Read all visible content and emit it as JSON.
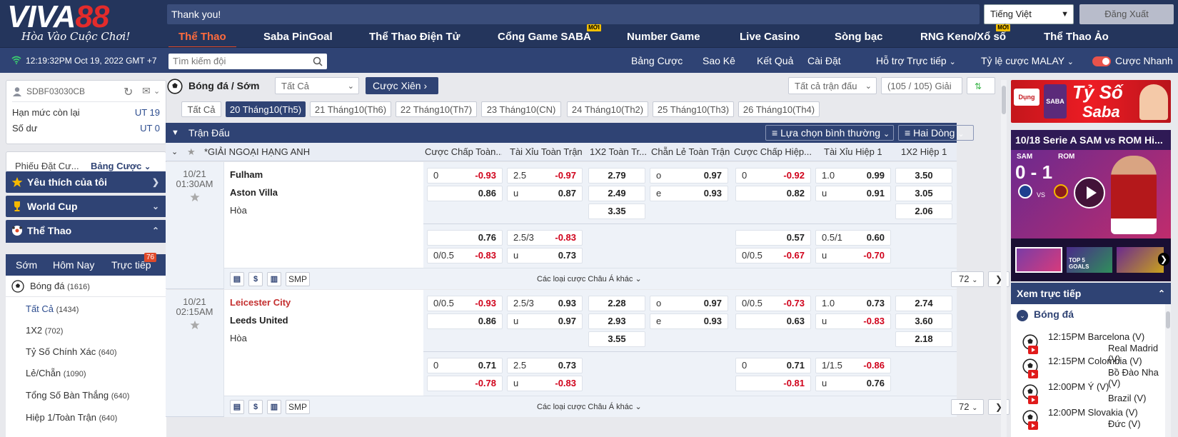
{
  "header": {
    "logo_text": "VIVA",
    "logo_num": "88",
    "logo_slogan": "Hòa Vào Cuộc Chơi!",
    "marquee": "Thank you!",
    "language": "Tiếng Việt",
    "logout": "Đăng Xuất",
    "nav": [
      {
        "label": "Thể Thao",
        "active": true
      },
      {
        "label": "Saba PinGoal"
      },
      {
        "label": "Thể Thao Điện Tử"
      },
      {
        "label": "Cổng Game SABA",
        "badge": "MỚI"
      },
      {
        "label": "Number Game"
      },
      {
        "label": "Live Casino"
      },
      {
        "label": "Sòng bạc"
      },
      {
        "label": "RNG Keno/Xổ số",
        "badge": "MỚI"
      },
      {
        "label": "Thể Thao Ảo"
      }
    ]
  },
  "subbar": {
    "time": "12:19:32PM Oct 19, 2022 GMT +7",
    "search_placeholder": "Tìm kiếm đội",
    "links": [
      "Bảng Cược",
      "Sao Kê",
      "Kết Quả",
      "Cài Đặt",
      "Hỗ trợ Trực tiếp",
      "Tỷ lệ cược MALAY",
      "Cược Nhanh"
    ]
  },
  "account": {
    "id": "SDBF03030CB",
    "limit_label": "Hạn mức còn lại",
    "limit_value": "UT 19",
    "balance_label": "Số dư",
    "balance_value": "UT 0"
  },
  "betslip": {
    "tab1": "Phiếu Đặt Cư...",
    "tab2": "Bảng Cược"
  },
  "sidebar": {
    "favorites": "Yêu thích của tôi",
    "worldcup": "World Cup",
    "sports": "Thể Thao",
    "tabs": [
      "Sớm",
      "Hôm Nay",
      "Trực tiếp"
    ],
    "live_count": "76",
    "items": [
      {
        "label": "Bóng đá",
        "count": "(1616)"
      },
      {
        "label": "Tất Cả",
        "count": "(1434)"
      },
      {
        "label": "1X2",
        "count": "(702)"
      },
      {
        "label": "Tỷ Số Chính Xác",
        "count": "(640)"
      },
      {
        "label": "Lẻ/Chẵn",
        "count": "(1090)"
      },
      {
        "label": "Tổng Số Bàn Thắng",
        "count": "(640)"
      },
      {
        "label": "Hiệp 1/Toàn Trận",
        "count": "(640)"
      }
    ]
  },
  "center": {
    "sport_title": "Bóng đá / Sớm",
    "filter": "Tất Cả",
    "parlay": "Cược Xiên",
    "all_matches": "Tất cả trận đấu",
    "leagues": "(105 / 105) Giải",
    "dates": [
      "Tất Cả",
      "20 Tháng10(Th5)",
      "21 Tháng10(Th6)",
      "22 Tháng10(Th7)",
      "23 Tháng10(CN)",
      "24 Tháng10(Th2)",
      "25 Tháng10(Th3)",
      "26 Tháng10(Th4)"
    ],
    "match_header": "Trận Đấu",
    "view_select": "Lựa chọn bình thường",
    "rows_select": "Hai Dòng",
    "league": "*GIẢI NGOẠI HẠNG ANH",
    "columns": [
      "Cược Chấp Toàn...",
      "Tài Xỉu Toàn Trận",
      "1X2 Toàn Tr...",
      "Chẵn Lẻ Toàn Trận",
      "Cược Chấp Hiệp...",
      "Tài Xỉu Hiệp 1",
      "1X2 Hiệp 1"
    ],
    "more_label": "Các loại cược Châu Á khác",
    "smp": "SMP"
  },
  "matches": [
    {
      "date": "10/21",
      "time": "01:30AM",
      "home": "Fulham",
      "away": "Aston Villa",
      "draw": "Hòa",
      "fav": false,
      "r1": {
        "hdp": [
          "0",
          "-0.93",
          "",
          "0.86"
        ],
        "ou": [
          "2.5",
          "-0.97",
          "u",
          "0.87"
        ],
        "x12": [
          "2.79",
          "2.49",
          "3.35"
        ],
        "oe": [
          "o",
          "0.97",
          "e",
          "0.93"
        ],
        "hhdp": [
          "0",
          "-0.92",
          "",
          "0.82"
        ],
        "hou": [
          "1.0",
          "0.99",
          "u",
          "0.91"
        ],
        "hx12": [
          "3.50",
          "3.05",
          "2.06"
        ]
      },
      "r2": {
        "hdp": [
          "",
          "0.76",
          "0/0.5",
          "-0.83"
        ],
        "ou": [
          "2.5/3",
          "-0.83",
          "u",
          "0.73"
        ],
        "hhdp": [
          "",
          "0.57",
          "0/0.5",
          "-0.67"
        ],
        "hou": [
          "0.5/1",
          "0.60",
          "u",
          "-0.70"
        ]
      },
      "count": "72"
    },
    {
      "date": "10/21",
      "time": "02:15AM",
      "home": "Leicester City",
      "away": "Leeds United",
      "draw": "Hòa",
      "fav": true,
      "r1": {
        "hdp": [
          "0/0.5",
          "-0.93",
          "",
          "0.86"
        ],
        "ou": [
          "2.5/3",
          "0.93",
          "u",
          "0.97"
        ],
        "x12": [
          "2.28",
          "2.93",
          "3.55"
        ],
        "oe": [
          "o",
          "0.97",
          "e",
          "0.93"
        ],
        "hhdp": [
          "0/0.5",
          "-0.73",
          "",
          "0.63"
        ],
        "hou": [
          "1.0",
          "0.73",
          "u",
          "-0.83"
        ],
        "hx12": [
          "2.74",
          "3.60",
          "2.18"
        ]
      },
      "r2": {
        "hdp": [
          "0",
          "0.71",
          "",
          "-0.78"
        ],
        "ou": [
          "2.5",
          "0.73",
          "u",
          "-0.83"
        ],
        "hhdp": [
          "0",
          "0.71",
          "",
          "-0.81"
        ],
        "hou": [
          "1/1.5",
          "-0.86",
          "u",
          "0.76"
        ]
      },
      "count": "72"
    }
  ],
  "right": {
    "banner_title": "Tỷ Số",
    "banner_sub": "Saba",
    "banner_logo": "SABA",
    "banner_brand": "Dụng",
    "video_title": "10/18 Serie A SAM vs ROM Hi...",
    "score_home": "SAM",
    "score_away": "ROM",
    "score": "0 - 1",
    "vs": "VS",
    "thumb_label": "TOP 5 GOALS",
    "live_header": "Xem trực tiếp",
    "live_sport": "Bóng đá",
    "live": [
      {
        "time": "12:15PM",
        "home": "Barcelona (V)",
        "away": "Real Madrid (V)"
      },
      {
        "time": "12:15PM",
        "home": "Colombia (V)",
        "away": "Bồ Đào Nha (V)"
      },
      {
        "time": "12:00PM",
        "home": "Ý (V)",
        "away": "Brazil (V)"
      },
      {
        "time": "12:00PM",
        "home": "Slovakia (V)",
        "away": "Đức (V)"
      }
    ]
  },
  "colors": {
    "navy": "#24355c",
    "bar": "#2f4374",
    "accent": "#e04a2a",
    "negative": "#d0021b"
  }
}
